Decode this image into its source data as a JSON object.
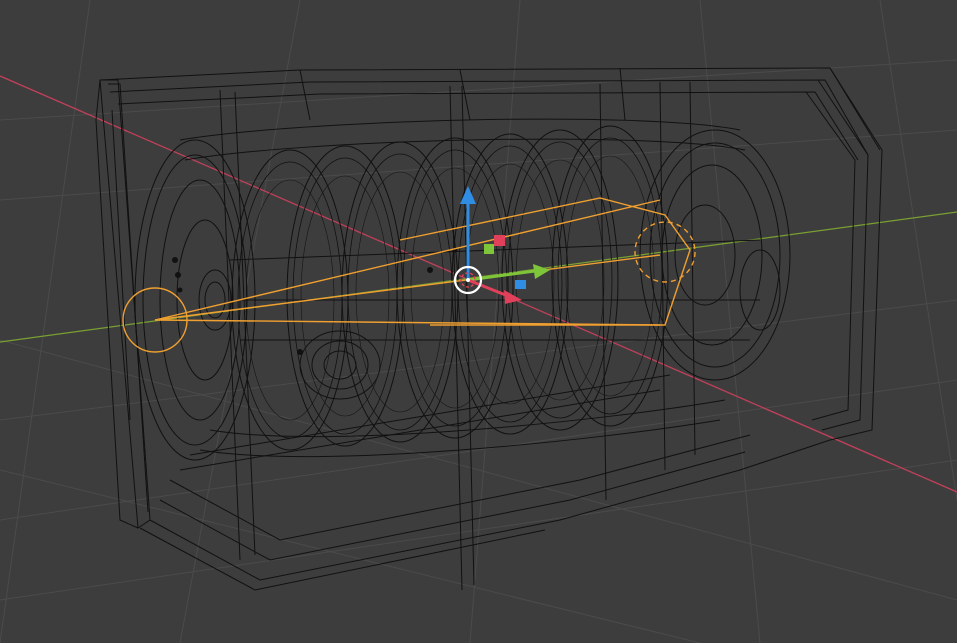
{
  "viewport": {
    "mode": "wireframe",
    "colors": {
      "background": "#3d3d3d",
      "grid": "#4a4a4a",
      "wire": "#111111",
      "x_axis": "#c2405a",
      "y_axis": "#7aa032",
      "selection": "#f0a030",
      "gizmo_x": "#e0405a",
      "gizmo_y": "#7ec53a",
      "gizmo_z": "#2f8de4",
      "gizmo_center": "#ffffff"
    },
    "icons": [
      "transform-gizmo-icon",
      "light-source-icon",
      "camera-target-icon"
    ]
  }
}
